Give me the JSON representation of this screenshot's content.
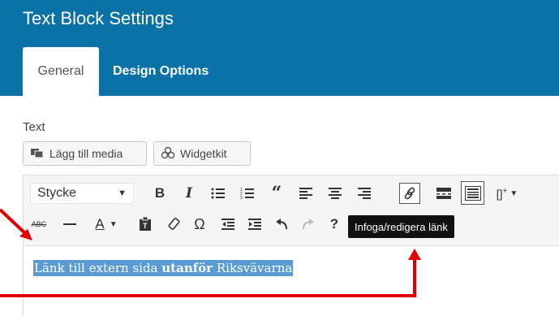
{
  "dialog": {
    "title": "Text Block Settings",
    "tabs": [
      {
        "label": "General",
        "active": true
      },
      {
        "label": "Design Options",
        "active": false
      }
    ]
  },
  "field": {
    "label": "Text",
    "buttons": {
      "add_media": "Lägg till media",
      "widgetkit": "Widgetkit"
    }
  },
  "toolbar": {
    "format_select": "Stycke",
    "icons_row1": [
      "bold-icon",
      "italic-icon",
      "bullet-list-icon",
      "numbered-list-icon",
      "blockquote-icon",
      "align-left-icon",
      "align-center-icon",
      "align-right-icon",
      "link-icon",
      "read-more-icon",
      "toolbar-toggle-icon",
      "shortcode-icon"
    ],
    "icons_row2": [
      "strikethrough-icon",
      "horizontal-rule-icon",
      "text-color-icon",
      "paste-text-icon",
      "clear-formatting-icon",
      "special-character-icon",
      "outdent-icon",
      "indent-icon",
      "undo-icon",
      "redo-icon",
      "help-icon"
    ],
    "link_tooltip": "Infoga/redigera länk"
  },
  "content": {
    "text_before": "Länk till extern sida ",
    "text_bold": "utanför",
    "text_after": " Riksvävarna"
  },
  "colors": {
    "header": "#0b72a8",
    "selection": "#5b9bd5",
    "annotation": "#e00000"
  }
}
